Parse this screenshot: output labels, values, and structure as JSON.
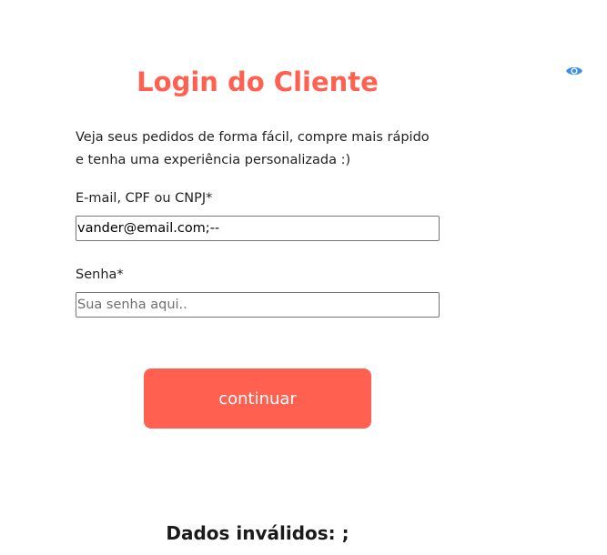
{
  "login": {
    "title": "Login do Cliente",
    "description_line1": "Veja seus pedidos de forma fácil, compre mais rápido",
    "description_line2": "e tenha uma experiência personalizada :)",
    "email_label": "E-mail, CPF ou CNPJ*",
    "email_value": "vander@email.com;--",
    "password_label": "Senha*",
    "password_placeholder": "Sua senha aqui..",
    "password_value": "",
    "submit_label": "continuar",
    "error_message": "Dados inválidos: ;"
  },
  "icons": {
    "toggle_visibility": "eye-icon"
  },
  "colors": {
    "accent": "#ff6050",
    "eye_icon": "#3a8ee6"
  }
}
